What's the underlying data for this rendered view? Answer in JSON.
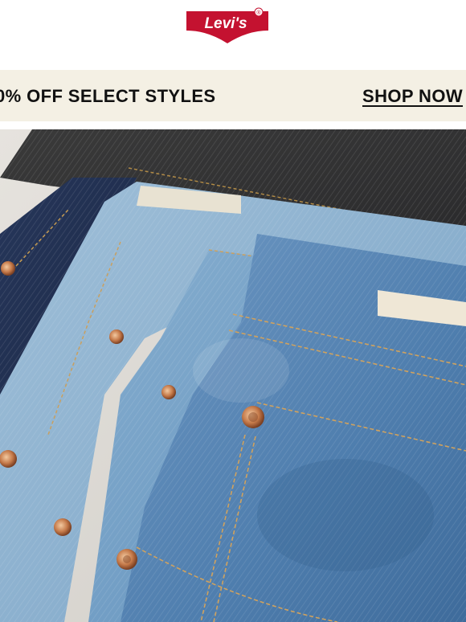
{
  "header": {
    "logo_text": "Levi's",
    "logo_mark": "®",
    "logo_color": "#c41230"
  },
  "promo": {
    "text": "0% OFF SELECT STYLES",
    "cta_label": "SHOP NOW",
    "background": "#f4f0e4"
  },
  "hero": {
    "icon": "stacked-denim-jeans-photo"
  }
}
